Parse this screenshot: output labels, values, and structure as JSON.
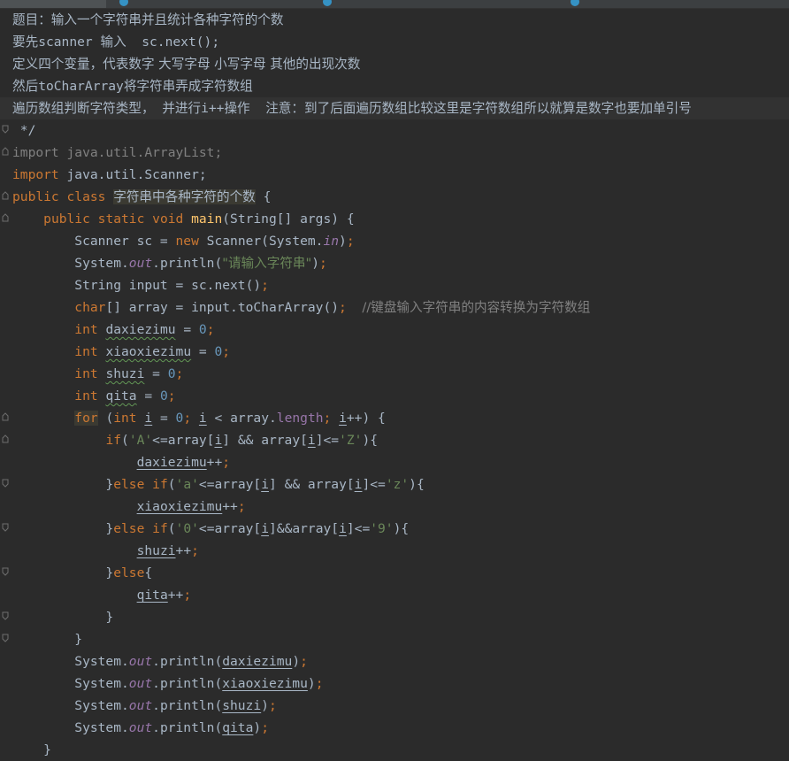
{
  "editor": {
    "doc_comment": [
      "题目：输入一个字符串并且统计各种字符的个数",
      "要先scanner 输入  sc.next();",
      "定义四个变量，代表数字 大写字母 小写字母 其他的出现次数",
      "然后toCharArray将字符串弄成字符数组",
      "遍历数组判断字符类型， 并进行i++操作  注意：到了后面遍历数组比较这里是字符数组所以就算是数字也要加单引号"
    ],
    "doc_end": " */",
    "imports": [
      "import java.util.ArrayList;",
      "java.util.Scanner;"
    ],
    "import_kw": "import",
    "class_name": "字符串中各种字符的个数",
    "prompt_string": "\"请输入字符串\"",
    "comment_convert": "//键盘输入字符串的内容转换为字符数组",
    "vars": [
      "daxiezimu",
      "xiaoxiezimu",
      "shuzi",
      "qita"
    ]
  },
  "colors": {
    "background": "#2b2b2b",
    "keyword": "#cc7832",
    "string": "#6a8759",
    "number": "#6897bb",
    "comment": "#808080",
    "method_decl": "#ffc66d",
    "field": "#9876aa"
  }
}
